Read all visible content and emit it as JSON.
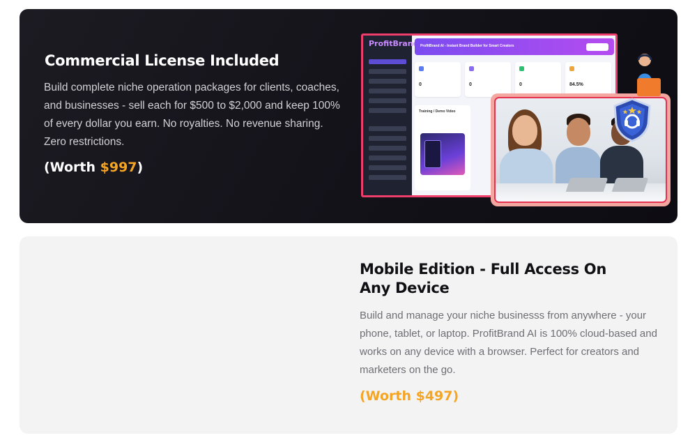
{
  "commercial": {
    "title": "Commercial License Included",
    "description": "Build complete niche operation packages for clients, coaches, and businesses - sell each for $500 to $2,000 and keep 100% of every dollar you earn. No royalties. No revenue sharing. Zero restrictions.",
    "worth_prefix": "(Worth ",
    "worth_price": "$997",
    "worth_suffix": ")"
  },
  "mockup": {
    "logo_text": "ProfitBrand",
    "banner_text": "ProfitBrand AI - Instant Brand Builder for Smart Creators",
    "stat_values": [
      "0",
      "0",
      "0",
      "84.5%"
    ],
    "panel_title": "Training / Demo Video"
  },
  "mobile": {
    "title": "Mobile Edition - Full Access On Any Device",
    "description": "Build and manage your niche businesss from anywhere - your phone, tablet, or laptop. ProfitBrand AI is 100% cloud-based and works on any device with a browser. Perfect for creators and marketers on the go.",
    "worth": "(Worth $497)"
  },
  "colors": {
    "accent_orange": "#f5a524",
    "dark_card": "#131219",
    "light_card": "#f3f3f4",
    "frame_red": "#e5314f"
  }
}
